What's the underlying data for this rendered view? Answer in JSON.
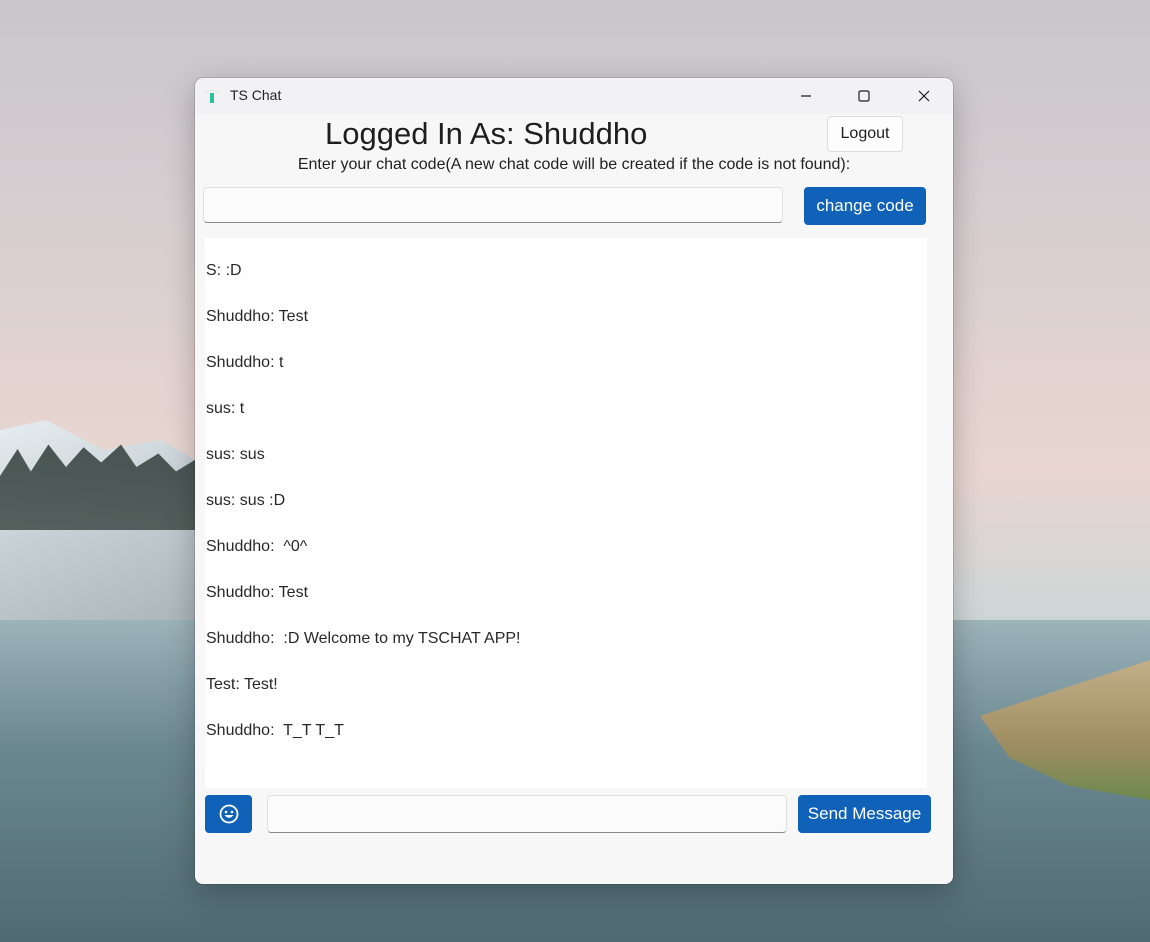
{
  "window": {
    "title": "TS Chat",
    "controls": {
      "minimize_icon": "minimize-icon",
      "maximize_icon": "maximize-icon",
      "close_icon": "close-icon"
    }
  },
  "header": {
    "title": "Logged In As: Shuddho",
    "logout_label": "Logout"
  },
  "chat_code": {
    "label": "Enter your chat code(A new chat code will be created if the code is not found):",
    "input_value": "",
    "button_label": "change code"
  },
  "messages": [
    "S: :D",
    "Shuddho: Test",
    "Shuddho: t",
    "sus: t",
    "sus: sus",
    "sus: sus :D",
    "Shuddho:  ^0^",
    "Shuddho: Test",
    "Shuddho:  :D Welcome to my TSCHAT APP!",
    "Test: Test!",
    "Shuddho:  T_T T_T"
  ],
  "composer": {
    "emoji_icon": "smiley-icon",
    "input_value": "",
    "send_label": "Send Message"
  },
  "colors": {
    "accent": "#0f62b8",
    "window_bg": "#f7f7f8",
    "text": "#1f1f1f"
  }
}
